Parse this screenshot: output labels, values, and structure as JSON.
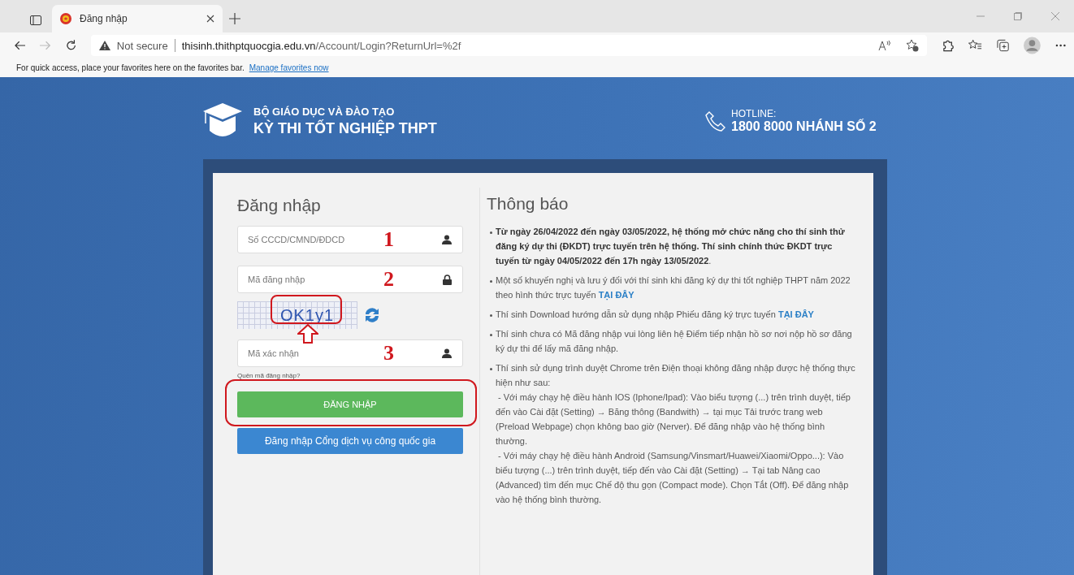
{
  "browser": {
    "tab": {
      "title": "Đăng nhập",
      "selected": true
    },
    "address": {
      "security": "Not secure",
      "domain": "thisinh.thithptquocgia.edu.vn",
      "path": "/Account/Login?ReturnUrl=%2f"
    },
    "favorites_bar": {
      "message": "For quick access, place your favorites here on the favorites bar.",
      "link": "Manage favorites now"
    }
  },
  "header": {
    "ministry": "BỘ GIÁO DỤC VÀ ĐÀO TẠO",
    "exam": "KỲ THI TỐT NGHIỆP THPT",
    "hotline_label": "HOTLINE:",
    "hotline_number": "1800 8000 NHÁNH SỐ 2"
  },
  "login": {
    "title": "Đăng nhập",
    "fields": [
      {
        "placeholder": "Số CCCD/CMND/ĐDCD",
        "annotation": "1",
        "kind": "person"
      },
      {
        "placeholder": "Mã đăng nhập",
        "annotation": "2",
        "kind": "secret"
      },
      {
        "placeholder": "Mã xác nhận",
        "annotation": "3",
        "kind": "person"
      }
    ],
    "captcha": {
      "code": "OK1y1"
    },
    "forgot_link": "Quên mã đăng nhập?",
    "login_button": "ĐĂNG NHẬP",
    "portal_button": "Đăng nhập Cổng dịch vụ công quốc gia"
  },
  "notice": {
    "title": "Thông báo",
    "items": [
      {
        "text": "**Từ ngày 26/04/2022 đến ngày 03/05/2022, hệ thống mở chức năng cho thí sinh thử đăng ký dự thi (ĐKDT) trực tuyến trên hệ thống. Thí sinh chính thức ĐKDT trực tuyến từ ngày 04/05/2022 đến 17h ngày 13/05/2022**."
      },
      {
        "text": "Một số khuyến nghị và lưu ý đối với thí sinh khi đăng ký dự thi tốt nghiệp THPT năm 2022 theo hình thức trực tuyến",
        "link": "TẠI ĐÂY"
      },
      {
        "text": "Thí sinh Download hướng dẫn sử dụng nhập Phiếu đăng ký trực tuyến",
        "link": "TẠI ĐÂY"
      },
      {
        "text": "Thí sinh chưa có Mã đăng nhập vui lòng liên hệ Điểm tiếp nhận hồ sơ nơi nộp hồ sơ đăng ký dự thi để lấy mã đăng nhập."
      },
      {
        "text": "Thí sinh sử dụng trình duyệt Chrome trên Điện thoại không đăng nhập được hệ thống thực hiện như sau:",
        "sub_items": [
          "- Với máy chạy hệ điều hành IOS (Iphone/Ipad): Vào biểu tượng (...) trên trình duyệt, tiếp đến vào Cài đặt (Setting) → Băng thông (Bandwith) → tại mục Tải trước trang web (Preload Webpage) chọn không bao giờ (Nerver). Để đăng nhập vào hệ thống bình thường.",
          "- Với máy chạy hệ điều hành Android (Samsung/Vinsmart/Huawei/Xiaomi/Oppo...): Vào biểu tượng (...) trên trình duyệt, tiếp đến vào Cài đặt (Setting) → Tại tab Nâng cao (Advanced) tìm đến mục Chế độ thu gọn (Compact mode). Chọn Tắt (Off). Để đăng nhập vào hệ thống bình thường."
        ]
      }
    ]
  }
}
